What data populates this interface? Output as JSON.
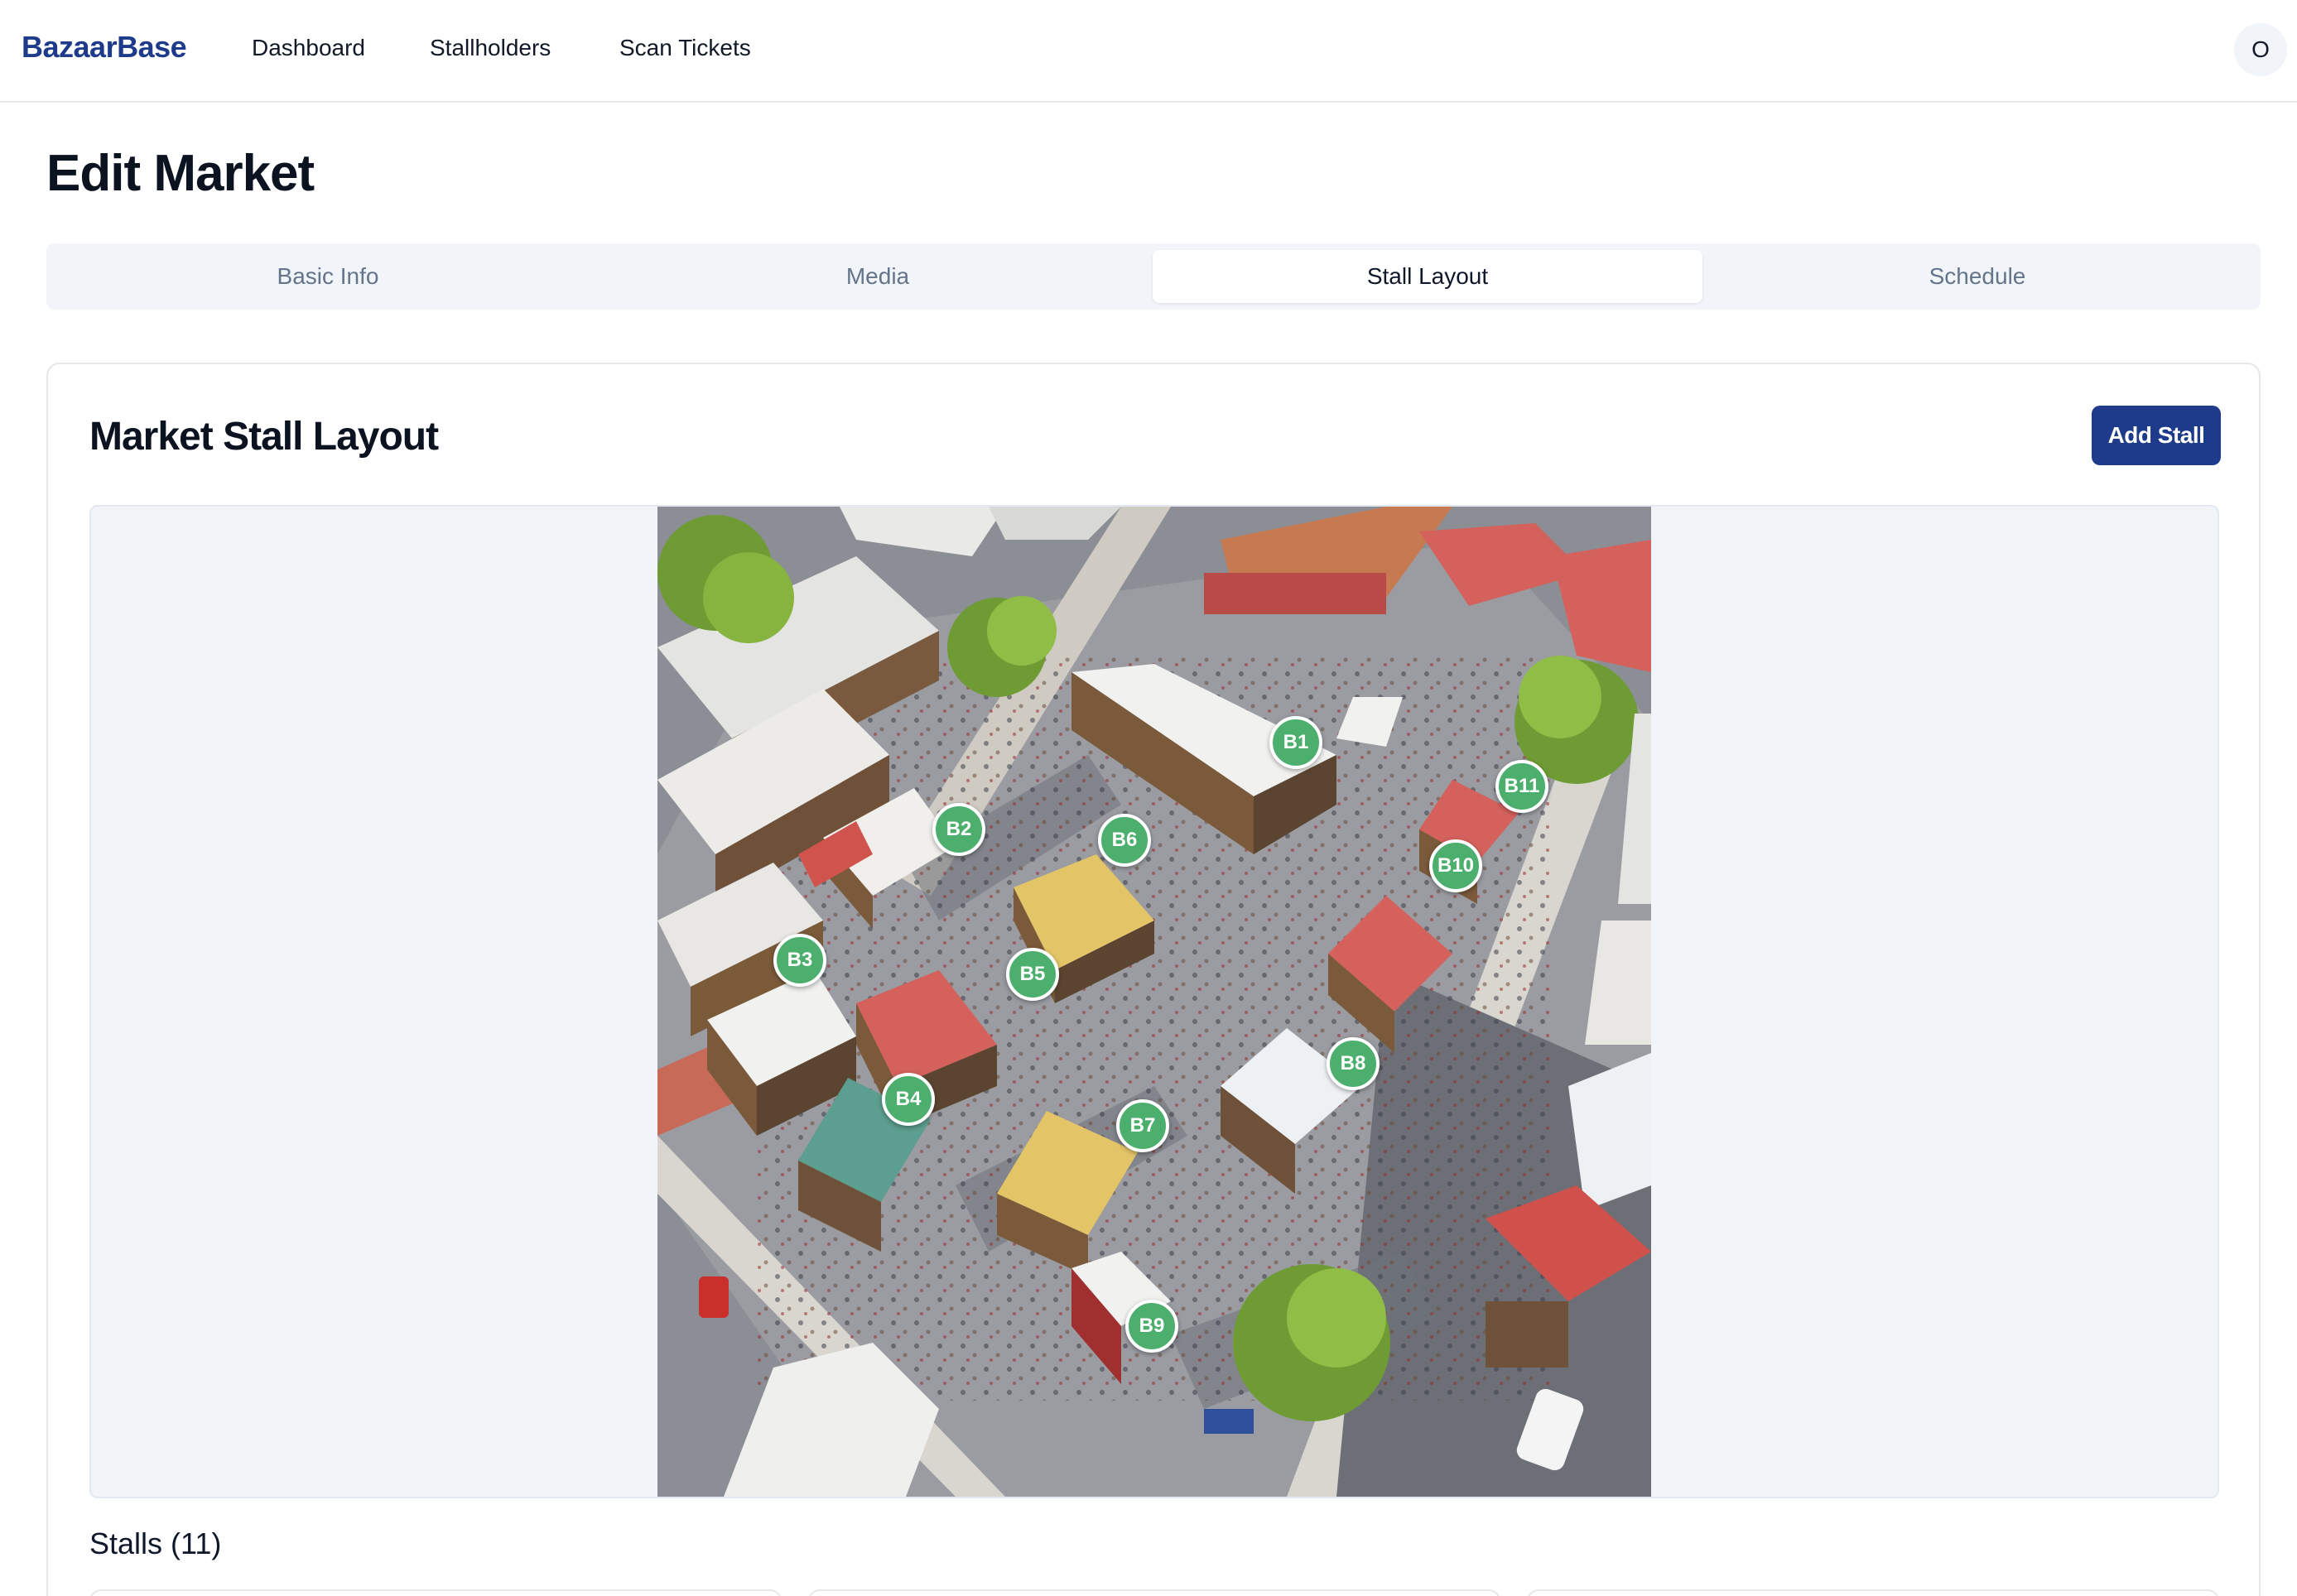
{
  "nav": {
    "brand": "BazaarBase",
    "links": [
      "Dashboard",
      "Stallholders",
      "Scan Tickets"
    ],
    "avatar_initial": "O"
  },
  "page": {
    "title": "Edit Market"
  },
  "tabs": [
    {
      "label": "Basic Info",
      "active": false
    },
    {
      "label": "Media",
      "active": false
    },
    {
      "label": "Stall Layout",
      "active": true
    },
    {
      "label": "Schedule",
      "active": false
    }
  ],
  "layout_card": {
    "title": "Market Stall Layout",
    "add_button": "Add Stall",
    "stalls_heading": "Stalls (11)"
  },
  "markers": [
    {
      "label": "B1"
    },
    {
      "label": "B2"
    },
    {
      "label": "B3"
    },
    {
      "label": "B4"
    },
    {
      "label": "B5"
    },
    {
      "label": "B6"
    },
    {
      "label": "B7"
    },
    {
      "label": "B8"
    },
    {
      "label": "B9"
    },
    {
      "label": "B10"
    },
    {
      "label": "B11"
    }
  ],
  "colors": {
    "brand": "#1e3a8a",
    "marker": "#4caf6e",
    "tab_bg": "#f1f5f9"
  }
}
